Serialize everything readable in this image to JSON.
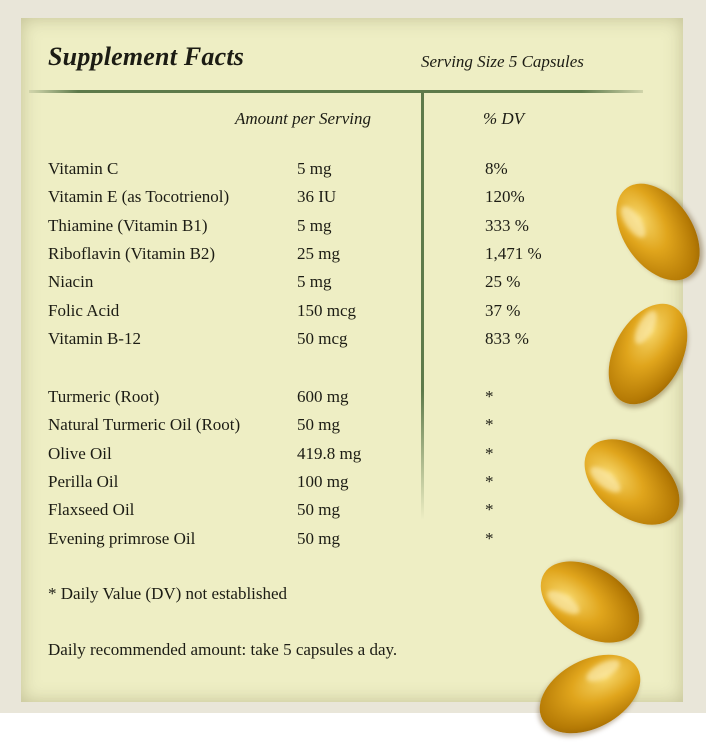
{
  "header": {
    "title": "Supplement Facts",
    "serving_size": "Serving Size 5 Capsules",
    "amount_header": "Amount per Serving",
    "dv_header": "% DV"
  },
  "vitamins": [
    {
      "name": "Vitamin C",
      "amount": "5 mg",
      "dv": "8%"
    },
    {
      "name": "Vitamin E (as Tocotrienol)",
      "amount": "36 IU",
      "dv": "120%"
    },
    {
      "name": "Thiamine (Vitamin B1)",
      "amount": "5 mg",
      "dv": "333 %"
    },
    {
      "name": "Riboflavin (Vitamin B2)",
      "amount": "25 mg",
      "dv": "1,471 %"
    },
    {
      "name": "Niacin",
      "amount": "5 mg",
      "dv": "25 %"
    },
    {
      "name": "Folic Acid",
      "amount": "150 mcg",
      "dv": "37 %"
    },
    {
      "name": "Vitamin B-12",
      "amount": "50 mcg",
      "dv": "833 %"
    }
  ],
  "oils": [
    {
      "name": "Turmeric (Root)",
      "amount": "600 mg",
      "dv": "*"
    },
    {
      "name": "Natural Turmeric Oil (Root)",
      "amount": "50 mg",
      "dv": "*"
    },
    {
      "name": "Olive Oil",
      "amount": "419.8 mg",
      "dv": "*"
    },
    {
      "name": "Perilla Oil",
      "amount": "100 mg",
      "dv": "*"
    },
    {
      "name": "Flaxseed Oil",
      "amount": "50 mg",
      "dv": "*"
    },
    {
      "name": "Evening primrose Oil",
      "amount": "50 mg",
      "dv": "*"
    }
  ],
  "footnote": "* Daily Value (DV) not established",
  "daily_recommendation": "Daily recommended amount: take 5 capsules a day.",
  "colors": {
    "panel_background": "#eeeec4",
    "rule_green": "#5d7a4a",
    "capsule_gold": "#e0a51c"
  }
}
